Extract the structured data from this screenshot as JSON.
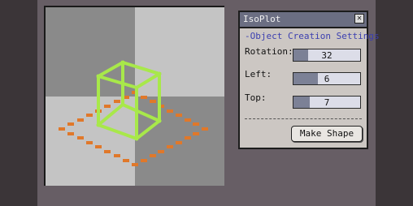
{
  "panel": {
    "title": "IsoPlot",
    "section_title": "-Object Creation Settings",
    "fields": [
      {
        "label": "Rotation:",
        "value": "32"
      },
      {
        "label": "Left:",
        "value": "6"
      },
      {
        "label": "Top:",
        "value": "7"
      }
    ],
    "make_button": "Make Shape"
  },
  "colors": {
    "plane": "#e0782a",
    "cube": "#a8e84a"
  }
}
